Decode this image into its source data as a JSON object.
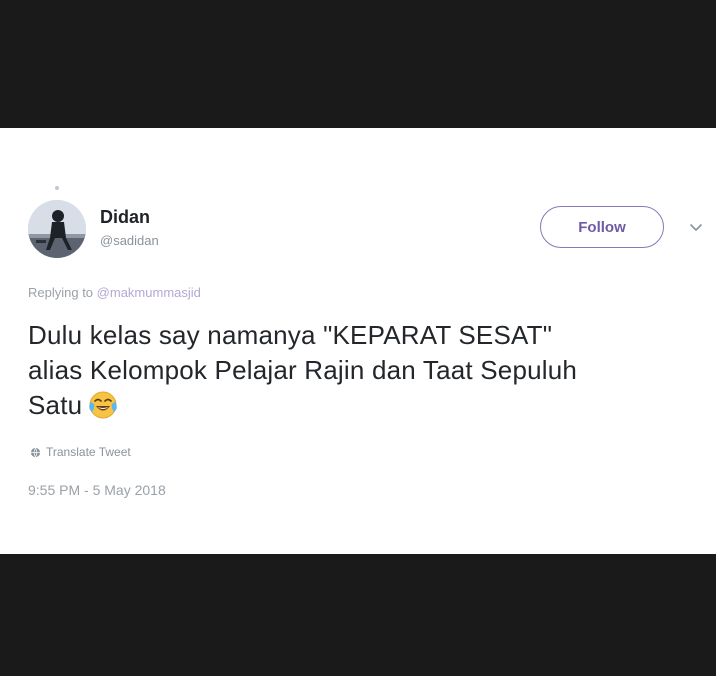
{
  "tweet": {
    "author_name": "Didan",
    "author_handle": "@sadidan",
    "follow_label": "Follow",
    "replying_prefix": "Replying to",
    "replying_to": "@makmummasjid",
    "text_line1": "Dulu kelas say namanya \"KEPARAT SESAT\"",
    "text_line2": "alias Kelompok Pelajar Rajin dan Taat Sepuluh",
    "text_line3": "Satu",
    "emoji": "face-with-tears-of-joy",
    "translate_label": "Translate Tweet",
    "timestamp": "9:55 PM - 5 May 2018"
  },
  "colors": {
    "background_bar": "#1a1a1a",
    "card": "#ffffff",
    "accent": "#6f5aa6",
    "text": "#23272b",
    "muted": "#9aa1a8"
  },
  "icons": {
    "more": "chevron-down-icon",
    "translate": "globe-icon"
  }
}
